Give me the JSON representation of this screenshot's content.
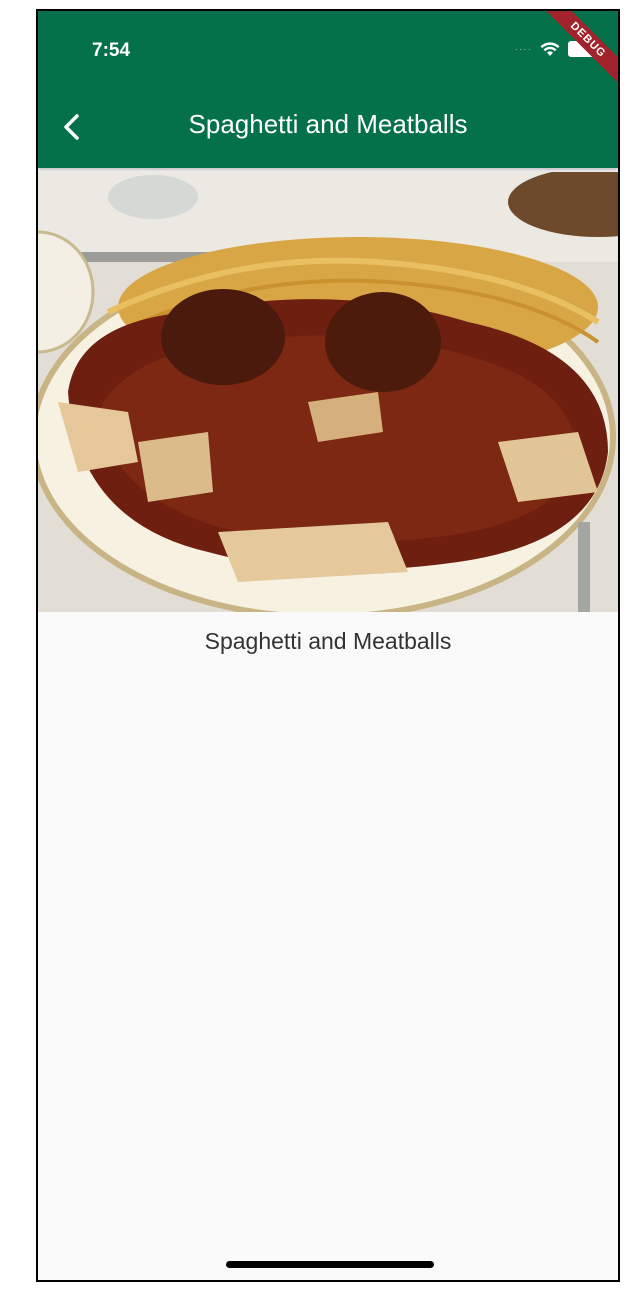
{
  "status_bar": {
    "time": "7:54",
    "icons": [
      "cellular-signal-icon",
      "wifi-icon",
      "battery-icon"
    ]
  },
  "debug_banner": {
    "label": "DEBUG"
  },
  "app_bar": {
    "title": "Spaghetti and Meatballs",
    "back_icon": "chevron-left-icon",
    "background_color": "#04714a"
  },
  "content": {
    "image_alt": "Plate of spaghetti and meatballs with ravioli in tomato sauce",
    "caption": "Spaghetti and Meatballs"
  }
}
